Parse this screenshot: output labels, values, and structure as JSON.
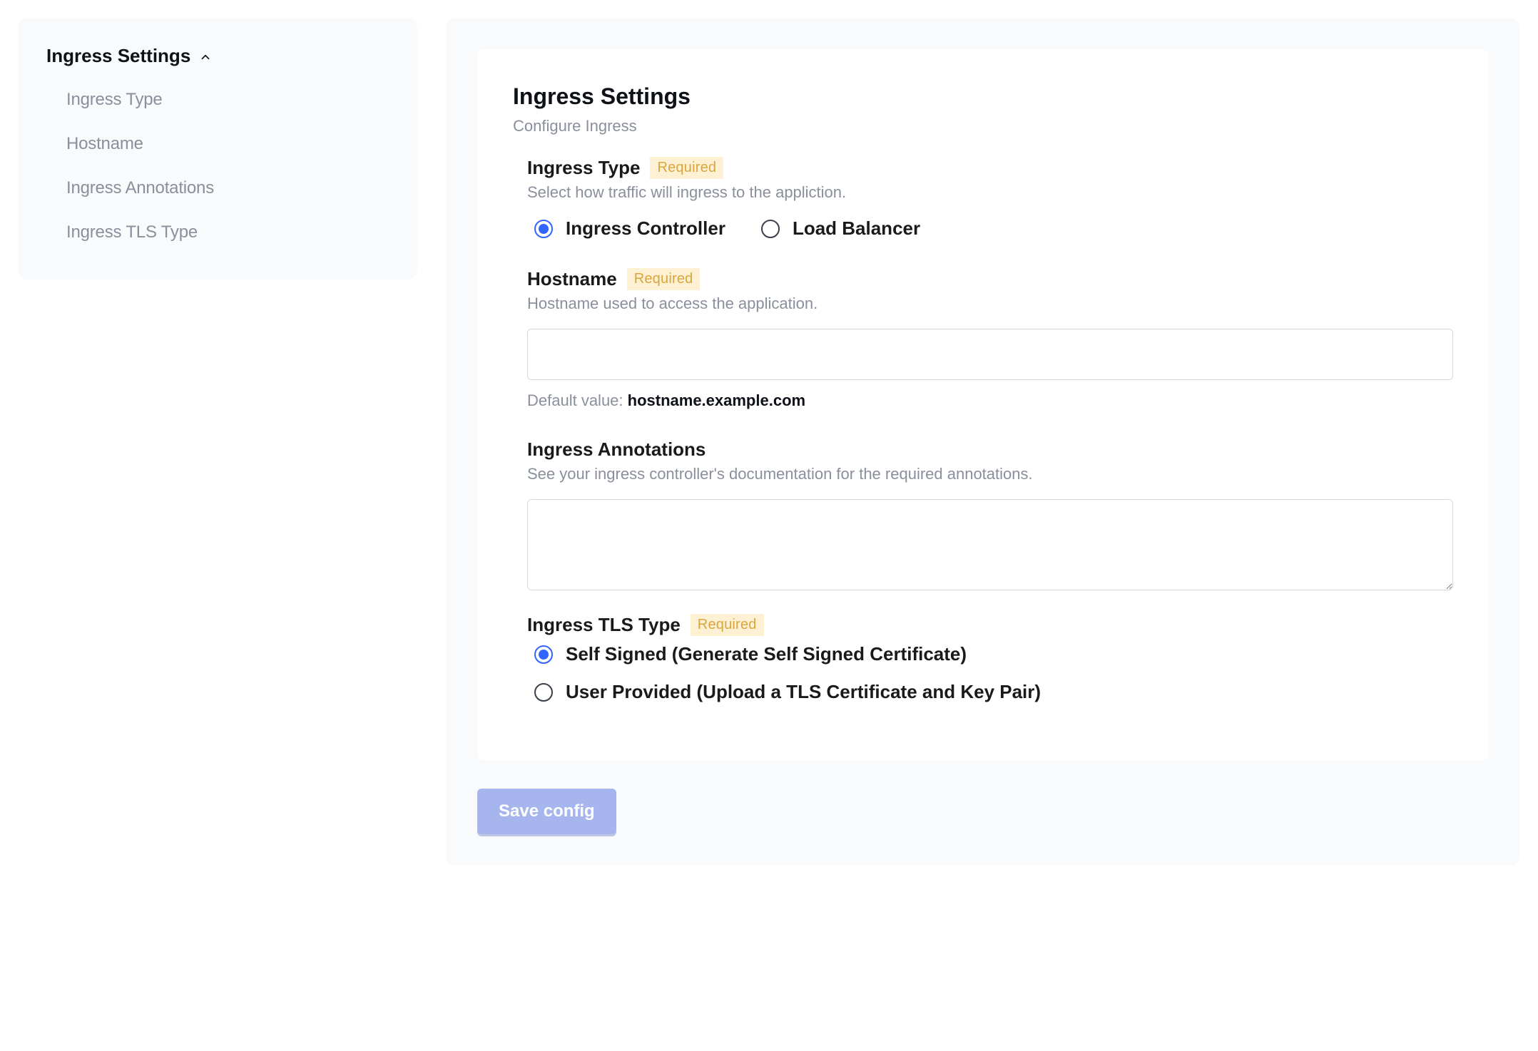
{
  "sidebar": {
    "title": "Ingress Settings",
    "items": [
      {
        "label": "Ingress Type"
      },
      {
        "label": "Hostname"
      },
      {
        "label": "Ingress Annotations"
      },
      {
        "label": "Ingress TLS Type"
      }
    ]
  },
  "main": {
    "title": "Ingress Settings",
    "subtitle": "Configure Ingress",
    "required_label": "Required",
    "fields": {
      "ingress_type": {
        "label": "Ingress Type",
        "help": "Select how traffic will ingress to the appliction.",
        "options": [
          {
            "label": "Ingress Controller",
            "selected": true
          },
          {
            "label": "Load Balancer",
            "selected": false
          }
        ]
      },
      "hostname": {
        "label": "Hostname",
        "help": "Hostname used to access the application.",
        "value": "",
        "default_prefix": "Default value: ",
        "default_value": "hostname.example.com"
      },
      "annotations": {
        "label": "Ingress Annotations",
        "help": "See your ingress controller's documentation for the required annotations.",
        "value": ""
      },
      "tls_type": {
        "label": "Ingress TLS Type",
        "options": [
          {
            "label": "Self Signed (Generate Self Signed Certificate)",
            "selected": true
          },
          {
            "label": "User Provided (Upload a TLS Certificate and Key Pair)",
            "selected": false
          }
        ]
      }
    },
    "save_label": "Save config"
  }
}
